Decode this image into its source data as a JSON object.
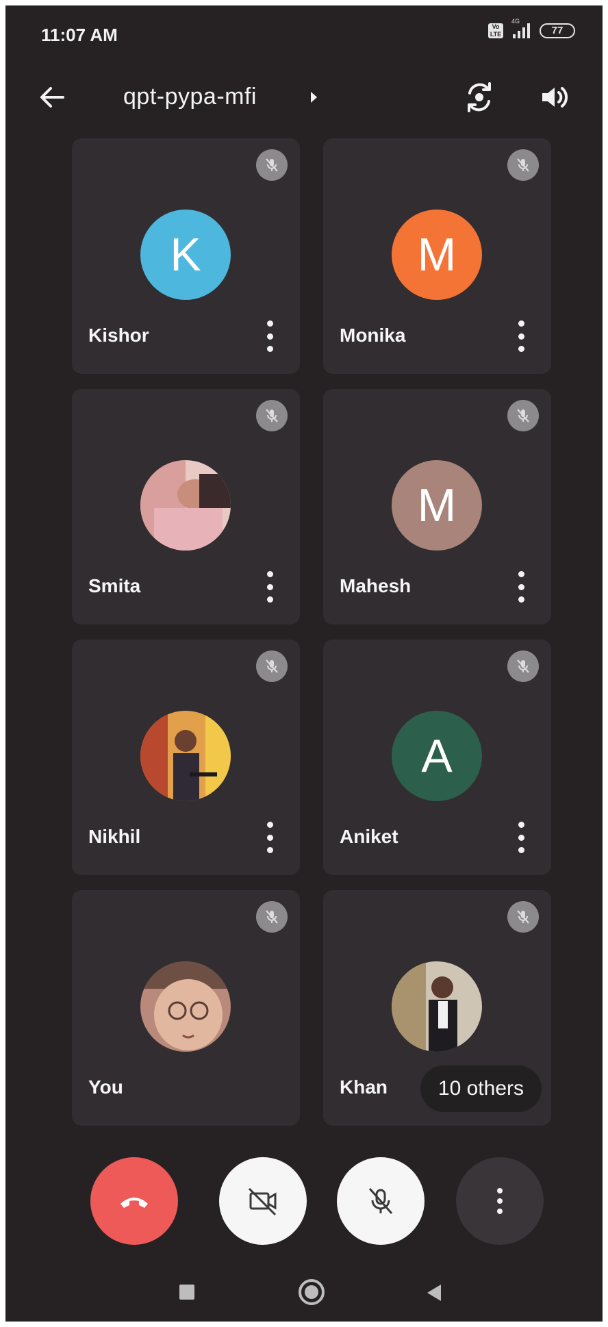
{
  "status_bar": {
    "time": "11:07 AM",
    "volte": "Vo LTE",
    "network": "4G",
    "battery": "77"
  },
  "header": {
    "meeting_code": "qpt-pypa-mfi"
  },
  "participants": [
    {
      "name": "Kishor",
      "initial": "K",
      "color": "#4db7dd"
    },
    {
      "name": "Monika",
      "initial": "M",
      "color": "#f47436"
    },
    {
      "name": "Smita",
      "initial": "",
      "color": "#d9b0b0"
    },
    {
      "name": "Mahesh",
      "initial": "M",
      "color": "#a8847a"
    },
    {
      "name": "Nikhil",
      "initial": "",
      "color": "#d07a3a"
    },
    {
      "name": "Aniket",
      "initial": "A",
      "color": "#2c5f4c"
    },
    {
      "name": "You",
      "initial": "",
      "color": "#c89a86"
    },
    {
      "name": "Khan",
      "initial": "",
      "color": "#b7a891"
    }
  ],
  "others_label": "10 others",
  "colors": {
    "end_call": "#ee5a57",
    "tile_bg": "#322d30",
    "screen_bg": "#262224"
  }
}
